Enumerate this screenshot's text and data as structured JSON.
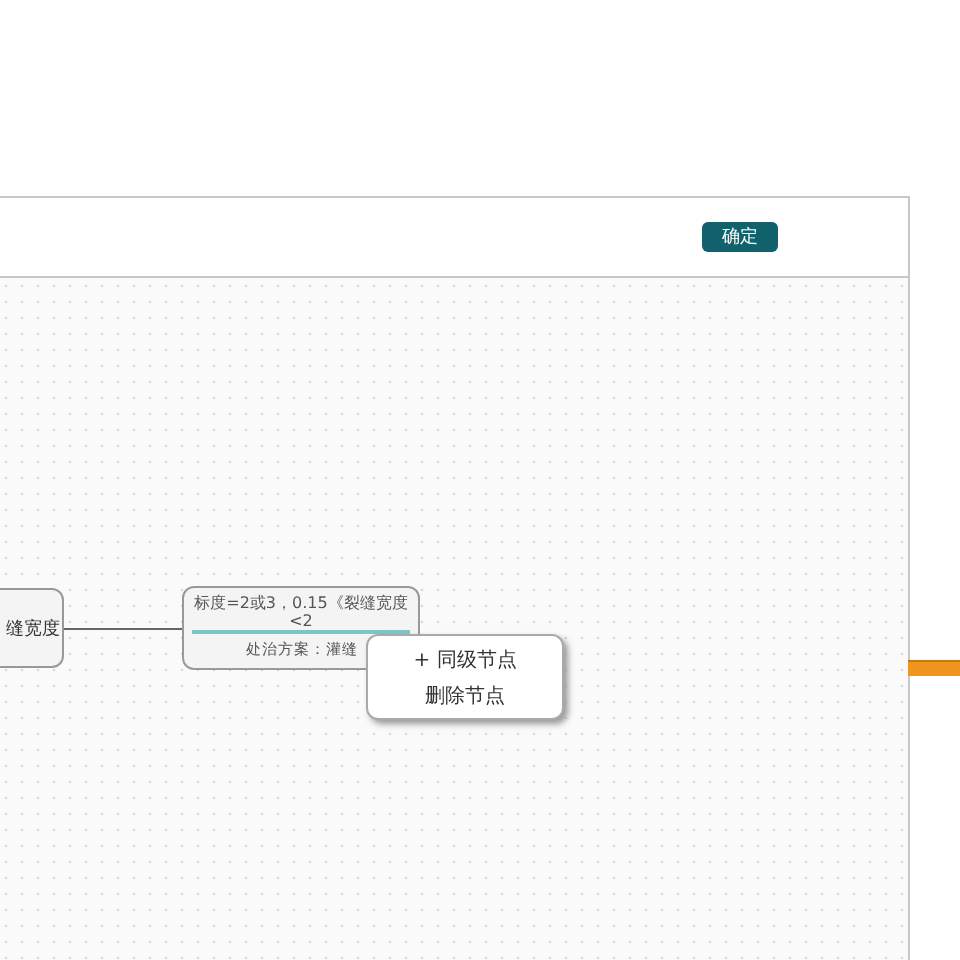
{
  "dialog": {
    "confirm_button": "确定"
  },
  "mindmap": {
    "nodes": [
      {
        "kind": "plain",
        "label": "缝宽度"
      },
      {
        "kind": "detail",
        "label": "标度=2或3，0.15《裂缝宽度<2",
        "note": "处治方案：灌缝"
      }
    ]
  },
  "context_menu": {
    "items": [
      "+ 同级节点",
      "删除节点"
    ]
  }
}
